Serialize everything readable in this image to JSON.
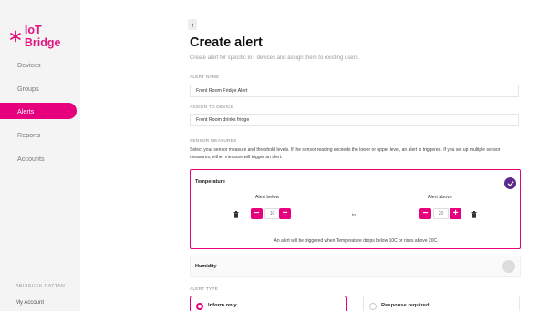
{
  "app": {
    "name": "IoT Bridge"
  },
  "colors": {
    "accent": "#e6007e",
    "check": "#5b2b8c"
  },
  "sidebar": {
    "items": [
      {
        "label": "Devices",
        "active": false
      },
      {
        "label": "Groups",
        "active": false
      },
      {
        "label": "Alerts",
        "active": true
      },
      {
        "label": "Reports",
        "active": false
      },
      {
        "label": "Accounts",
        "active": false
      }
    ],
    "user_name": "ABHISHEK RATTAN",
    "my_account": "My Account"
  },
  "header": {
    "back_icon": "‹",
    "title": "Create alert",
    "subtitle": "Create alert for specific IoT devices and assign them to existing users."
  },
  "form": {
    "alert_name": {
      "label": "ALERT NAME",
      "value": "Front Room Fridge Alert"
    },
    "assign_device": {
      "label": "ASSIGN TO DEVICE",
      "value": "Front Room drinks fridge"
    },
    "sensor_measures": {
      "label": "SENSOR MEASURES",
      "description": "Select your sensor measure and threshold levels. If the sensor reading exceeds the lower or upper level, an alert is triggered. If you set up multiple sensor measures, either measure will trigger an alert."
    },
    "temperature": {
      "title": "Temperature",
      "selected": true,
      "below_label": "Alert below",
      "below_value": "10",
      "to_label": "to",
      "above_label": "Alert above",
      "above_value": "20",
      "minus": "−",
      "plus": "+",
      "summary": "An alert will be triggered when Temperature drops below 10C or rises above 20C."
    },
    "humidity": {
      "title": "Humidity",
      "selected": false
    },
    "alert_type": {
      "label": "ALERT TYPE",
      "options": [
        {
          "label": "Inform only",
          "selected": true
        },
        {
          "label": "Response required",
          "selected": false
        }
      ]
    }
  }
}
